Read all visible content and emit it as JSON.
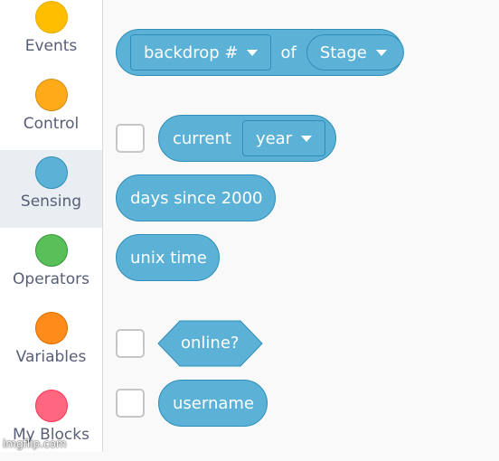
{
  "sidebar": {
    "categories": [
      {
        "label": "Events",
        "color": "#ffbf00",
        "border": "#e6ac00"
      },
      {
        "label": "Control",
        "color": "#ffab19",
        "border": "#cf8b17"
      },
      {
        "label": "Sensing",
        "color": "#5cb1d6",
        "border": "#2e8eb8",
        "active": true
      },
      {
        "label": "Operators",
        "color": "#59c059",
        "border": "#389438"
      },
      {
        "label": "Variables",
        "color": "#ff8c1a",
        "border": "#db6e00"
      },
      {
        "label": "My Blocks",
        "color": "#ff6680",
        "border": "#ff3355"
      }
    ]
  },
  "blocks": {
    "backdrop": {
      "menu_label": "backdrop #",
      "of_label": "of",
      "target_label": "Stage"
    },
    "current": {
      "label": "current",
      "menu_label": "year"
    },
    "days_since": {
      "label": "days since 2000"
    },
    "unix_time": {
      "label": "unix time"
    },
    "online": {
      "label": "online?"
    },
    "username": {
      "label": "username"
    }
  },
  "watermark": "imgflip.com",
  "colors": {
    "sensing": "#5cb1d6",
    "sensing_border": "#2e8eb8",
    "text_gray": "#575e75"
  }
}
